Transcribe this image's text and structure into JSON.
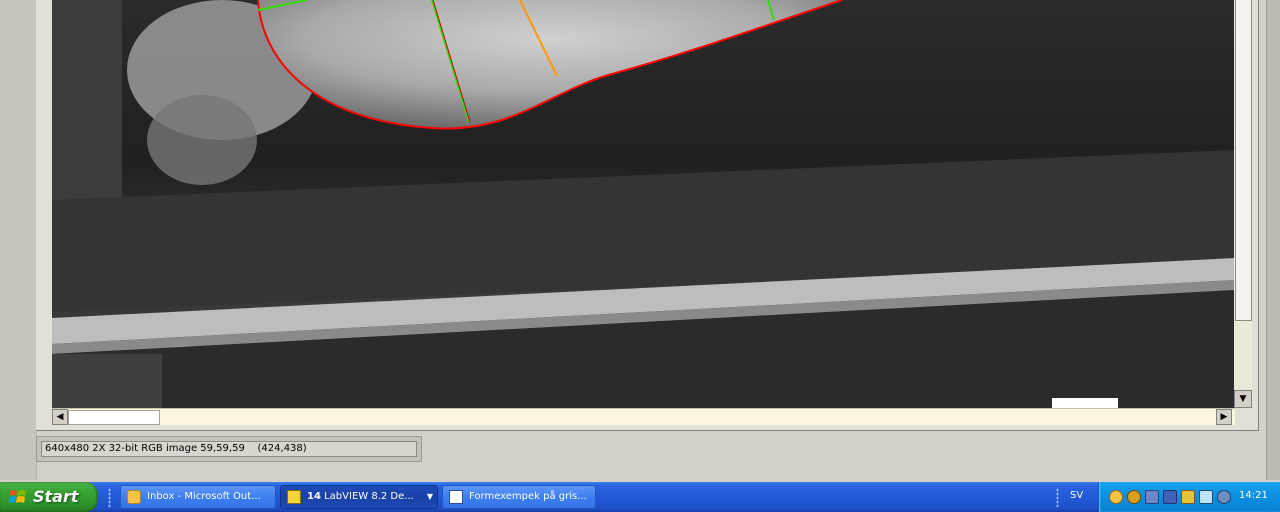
{
  "status_bar": {
    "image_info": "640x480 2X 32-bit RGB image 59,59,59    (424,438)"
  },
  "image_view": {
    "overlay_colors": {
      "contour": "#ff0000",
      "axis_green": "#33dd00",
      "axis_orange": "#ff9900"
    }
  },
  "taskbar": {
    "start_label": "Start",
    "tasks": [
      {
        "label": "Inbox - Microsoft Out...",
        "icon": "outlook-icon"
      },
      {
        "count": "14",
        "label": "LabVIEW 8.2 De...",
        "icon": "labview-icon"
      },
      {
        "label": "Formexempek på gris...",
        "icon": "word-icon"
      }
    ],
    "language": "SV",
    "clock": "14:21",
    "tray_icons": [
      "outlook-tray-icon",
      "security-icon",
      "network-icon",
      "usb-icon",
      "pen-icon",
      "monitor-icon",
      "help-icon"
    ]
  }
}
